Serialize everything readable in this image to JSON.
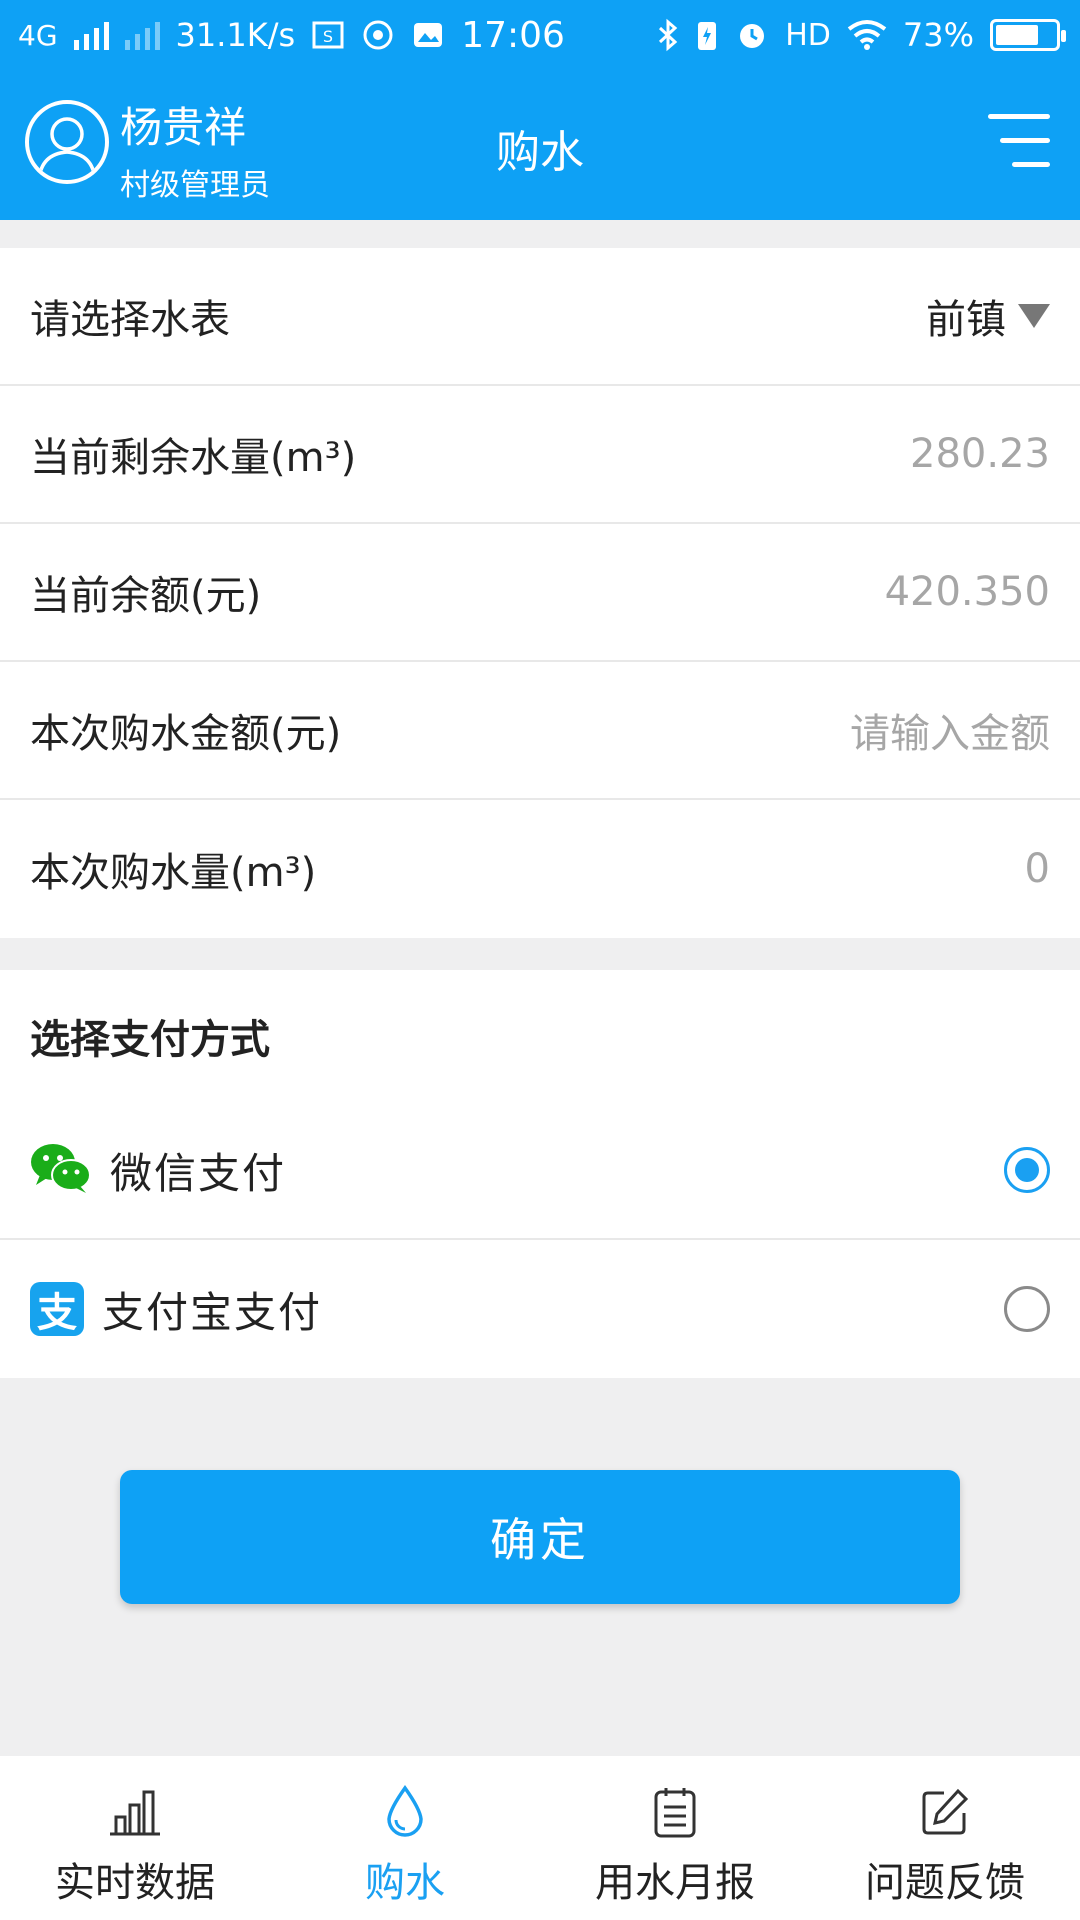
{
  "status_bar": {
    "network": "4G",
    "speed": "31.1K/s",
    "time": "17:06",
    "hd": "HD",
    "battery": "73%",
    "battery_fraction": 0.73
  },
  "header": {
    "user_name": "杨贵祥",
    "user_role": "村级管理员",
    "title": "购水"
  },
  "form": {
    "meter_label": "请选择水表",
    "meter_value": "前镇",
    "remaining_water_label": "当前剩余水量(m³)",
    "remaining_water_value": "280.23",
    "balance_label": "当前余额(元)",
    "balance_value": "420.350",
    "amount_label": "本次购水金额(元)",
    "amount_placeholder": "请输入金额",
    "quantity_label": "本次购水量(m³)",
    "quantity_value": "0"
  },
  "payment": {
    "title": "选择支付方式",
    "options": [
      {
        "label": "微信支付",
        "icon": "wechat-icon",
        "selected": true
      },
      {
        "label": "支付宝支付",
        "icon": "alipay-icon",
        "icon_glyph": "支",
        "selected": false
      }
    ]
  },
  "confirm_label": "确定",
  "bottom_nav": [
    {
      "label": "实时数据",
      "icon": "bar-chart-icon",
      "active": false
    },
    {
      "label": "购水",
      "icon": "water-drop-icon",
      "active": true
    },
    {
      "label": "用水月报",
      "icon": "report-icon",
      "active": false
    },
    {
      "label": "问题反馈",
      "icon": "edit-icon",
      "active": false
    }
  ],
  "colors": {
    "primary": "#0ea1f5",
    "wechat_green": "#1aad19",
    "alipay_blue": "#17a3ee"
  }
}
